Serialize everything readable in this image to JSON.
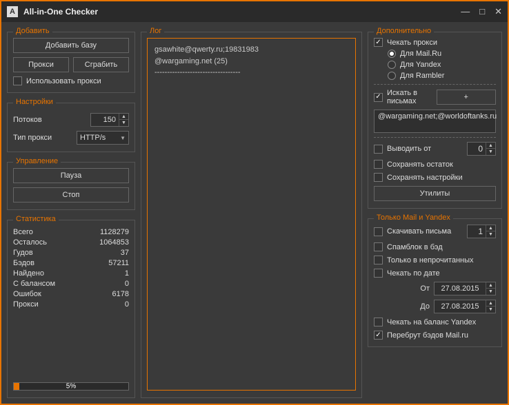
{
  "title": "All-in-One Checker",
  "left": {
    "add": {
      "legend": "Добавить",
      "add_base": "Добавить базу",
      "proxy": "Прокси",
      "grab": "Сграбить",
      "use_proxy": "Использовать прокси"
    },
    "settings": {
      "legend": "Настройки",
      "threads_label": "Потоков",
      "threads_value": "150",
      "proxy_type_label": "Тип прокси",
      "proxy_type_value": "HTTP/s"
    },
    "control": {
      "legend": "Управление",
      "pause": "Пауза",
      "stop": "Стоп"
    },
    "stats": {
      "legend": "Статистика",
      "rows": [
        {
          "label": "Всего",
          "value": "1128279"
        },
        {
          "label": "Осталось",
          "value": "1064853"
        },
        {
          "label": "Гудов",
          "value": "37"
        },
        {
          "label": "Бэдов",
          "value": "57211"
        },
        {
          "label": "Найдено",
          "value": "1"
        },
        {
          "label": "С балансом",
          "value": "0"
        },
        {
          "label": "Ошибок",
          "value": "6178"
        },
        {
          "label": "Прокси",
          "value": "0"
        }
      ],
      "progress_pct": "5%"
    }
  },
  "log": {
    "legend": "Лог",
    "content": "gsawhite@qwerty.ru;19831983\n@wargaming.net (25)\n----------------------------------"
  },
  "right": {
    "additional": {
      "legend": "Дополнительно",
      "check_proxy": "Чекать прокси",
      "for_mailru": "Для Mail.Ru",
      "for_yandex": "Для Yandex",
      "for_rambler": "Для Rambler",
      "search_mail": "Искать в письмах",
      "plus": "+",
      "search_text": "@wargaming.net;@worldoftanks.ru",
      "output_from": "Выводить от",
      "output_from_value": "0",
      "save_rest": "Сохранять остаток",
      "save_settings": "Сохранять настройки",
      "utilities": "Утилиты"
    },
    "mail_yandex": {
      "legend": "Только Mail и Yandex",
      "download_mail": "Скачивать письма",
      "download_count": "1",
      "spamblock": "Спамблок в бэд",
      "unread_only": "Только в непрочитанных",
      "check_by_date": "Чекать по дате",
      "from_label": "От",
      "from_date": "27.08.2015",
      "to_label": "До",
      "to_date": "27.08.2015",
      "check_balance": "Чекать на баланс Yandex",
      "rebrute": "Перебрут бэдов Mail.ru"
    }
  }
}
